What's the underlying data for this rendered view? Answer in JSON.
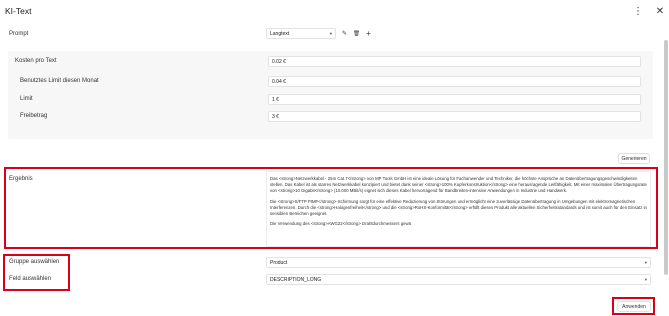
{
  "header": {
    "title": "KI-Text",
    "more_icon": "⋮",
    "close_icon": "✕"
  },
  "prompt": {
    "label": "Prompt",
    "selected": "Langtext",
    "chevron": "▾",
    "edit_icon": "✎",
    "delete_icon": "🗑",
    "add_icon": "+"
  },
  "costs": {
    "cost_label": "Kosten pro Text",
    "cost_value": "0.02 €",
    "used_label": "Benutztes Limit diesen Monat",
    "used_value": "0.04 €",
    "limit_label": "Limit",
    "limit_value": "1 €",
    "free_label": "Freibetrag",
    "free_value": "3 €"
  },
  "generate_label": "Generieren",
  "result": {
    "label": "Ergebnis",
    "p1": "Das <strong>Netzwerkkabel - 25m Cat.7</strong> von MP Tools GmbH ist eine ideale Lösung für Fachanwender und Techniker, die höchste Ansprüche an Datenübertragungsgeschwindigkeiten stellen. Das Kabel ist als starres Netzwerkkabel konzipiert und bietet dank seiner <strong>100% Kupferkonstruktion</strong> eine herausragende Leitfähigkeit. Mit einer maximalen Übertragungsrate von <strong>10 Gigabit</strong> (10.000 MBit/s) eignet sich dieses Kabel hervorragend für Bandbreiten-intensive Anwendungen in Industrie und Handwerk.",
    "p2": "Die <strong>S/FTP PIMF</strong>-Schirmung sorgt für eine effektive Reduzierung von Störungen und ermöglicht eine zuverlässige Datenübertragung in Umgebungen mit elektromagnetischen Interferenzen. Durch die <strong>Halogenfreiheit</strong> und die <strong>RoHS-Konformität</strong> erfüllt dieses Produkt alle aktuellen Sicherheitsstandards und ist somit auch für den Einsatz in sensiblen Bereichen geeignet.",
    "p3": "Die Verwendung des <strong>AWG22</strong> Drahtdurchmessers gewä"
  },
  "group": {
    "label": "Gruppe auswählen",
    "value": "Product"
  },
  "field": {
    "label": "Feld auswählen",
    "value": "DESCRIPTION_LONG"
  },
  "apply_label": "Anwenden",
  "colors": {
    "highlight": "#d9001b",
    "panel_bg": "#f7f7f7"
  }
}
